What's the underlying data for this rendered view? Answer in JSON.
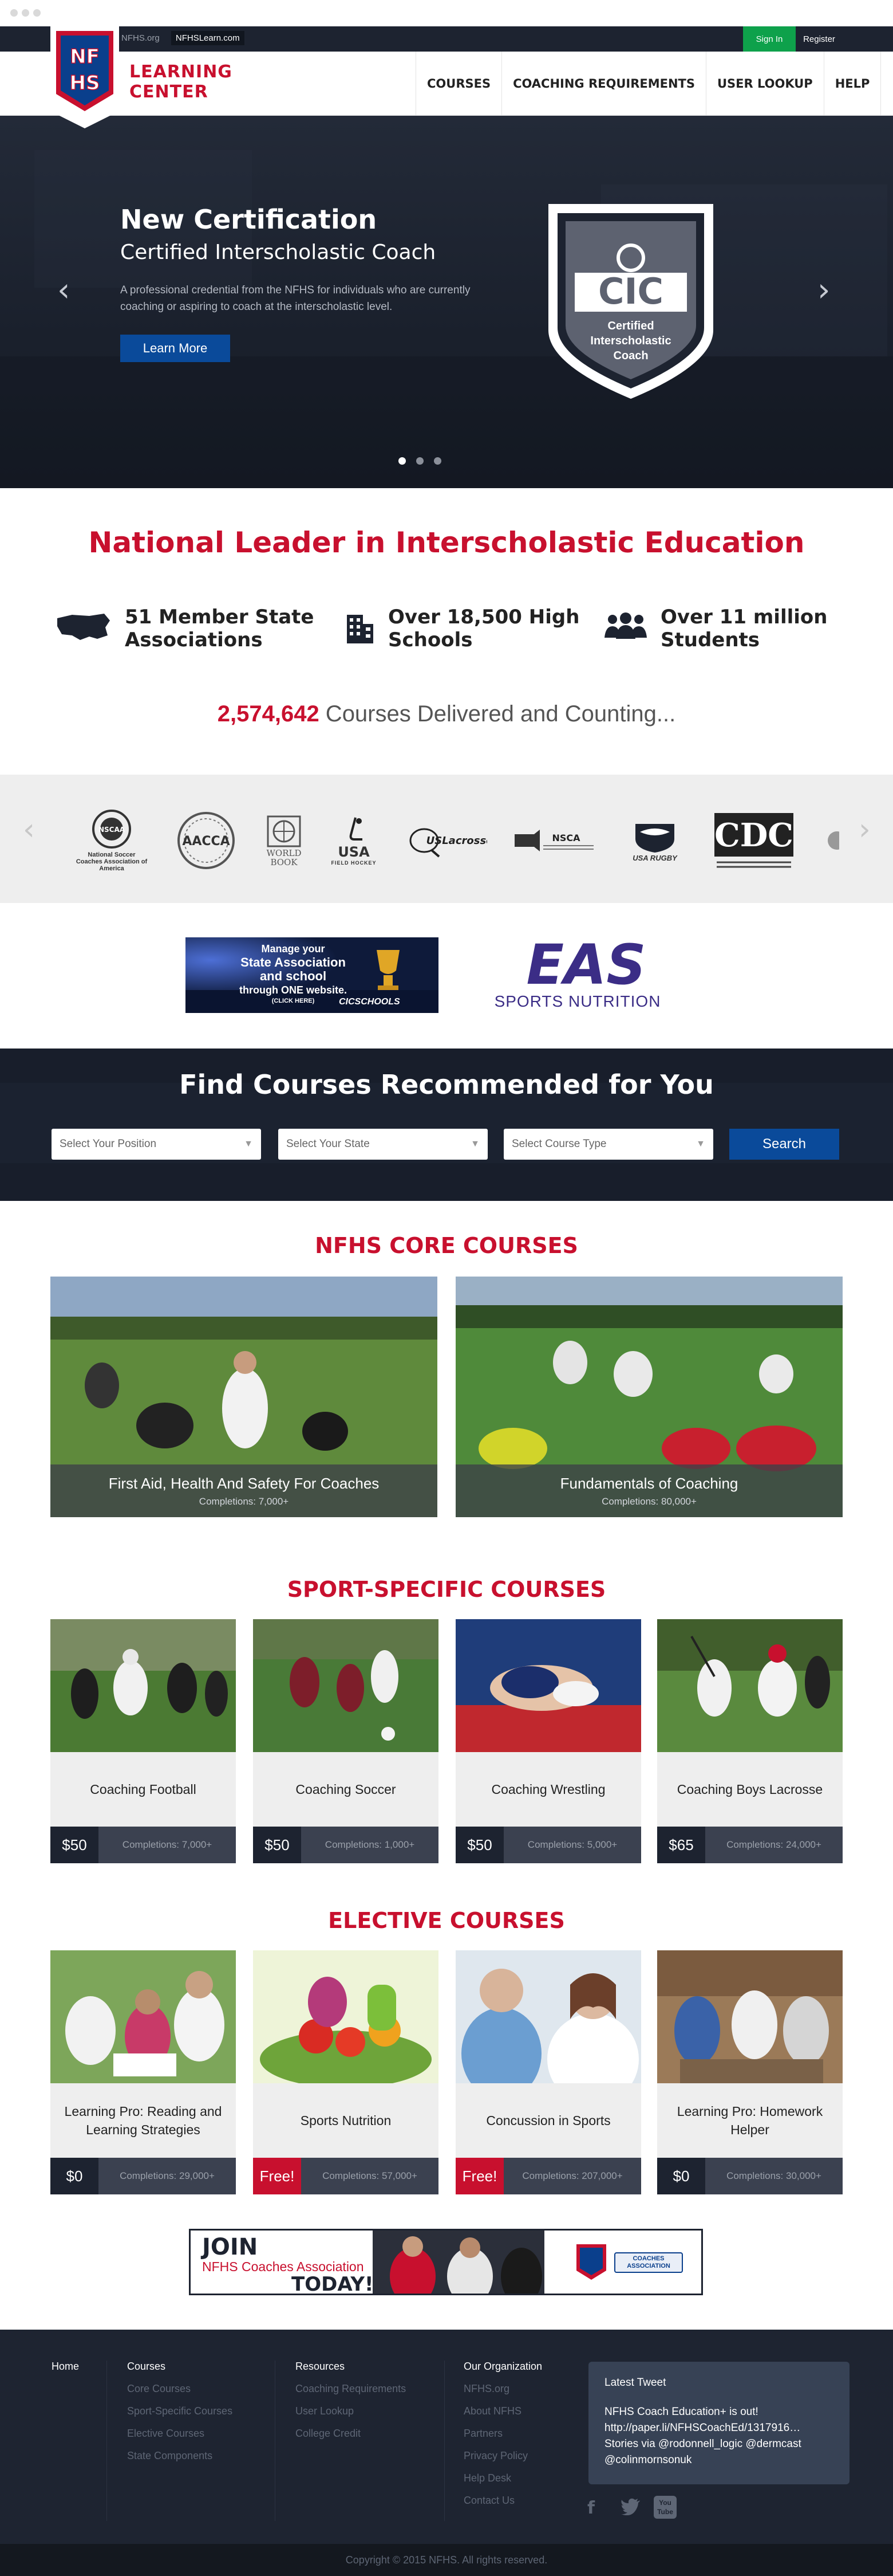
{
  "topbar": {
    "site_link_1": "NFHS.org",
    "site_link_2": "NFHSLearn.com",
    "signin": "Sign In",
    "register": "Register"
  },
  "brand": {
    "logo_text": "NFHS",
    "name_line1": "LEARNING",
    "name_line2": "CENTER"
  },
  "nav": {
    "items": [
      {
        "label": "COURSES"
      },
      {
        "label": "COACHING REQUIREMENTS"
      },
      {
        "label": "USER LOOKUP"
      },
      {
        "label": "HELP"
      }
    ]
  },
  "hero": {
    "title": "New Certification",
    "subtitle": "Certified Interscholastic Coach",
    "description": "A professional credential from the NFHS for individuals who are currently coaching or aspiring to coach at the interscholastic level.",
    "button": "Learn More",
    "badge_abbr": "CIC",
    "badge_line1": "Certified",
    "badge_line2": "Interscholastic",
    "badge_line3": "Coach",
    "active_slide": 1,
    "slide_count": 3
  },
  "leader": {
    "title": "National Leader in Interscholastic Education",
    "stats": [
      {
        "line1": "51 Member State",
        "line2": "Associations",
        "icon": "usa-map-icon"
      },
      {
        "line1": "Over 18,500 High",
        "line2": "Schools",
        "icon": "school-building-icon"
      },
      {
        "line1": "Over 11 million",
        "line2": "Students",
        "icon": "students-group-icon"
      }
    ],
    "count_number": "2,574,642",
    "count_text": " Courses Delivered and Counting..."
  },
  "partners": {
    "items": [
      {
        "name": "National Soccer Coaches Association of America",
        "short": "NSCAA"
      },
      {
        "name": "AACCA",
        "short": "AACCA"
      },
      {
        "name": "WORLD BOOK",
        "short": "WORLD BOOK"
      },
      {
        "name": "USA FIELD HOCKEY",
        "short": "USA"
      },
      {
        "name": "US Lacrosse",
        "short": "USLacrosse"
      },
      {
        "name": "NSCA",
        "short": "NSCA"
      },
      {
        "name": "USA RUGBY",
        "short": "USA RUGBY"
      },
      {
        "name": "CDC",
        "short": "CDC"
      }
    ]
  },
  "ads": {
    "left_line1": "Manage your",
    "left_line2": "State Association",
    "left_line3": "and school",
    "left_line4": "through ONE website.",
    "left_line5": "(CLICK HERE)",
    "left_brand": "CICSCHOOLS",
    "right_brand": "EAS",
    "right_sub": "SPORTS NUTRITION"
  },
  "finder": {
    "title": "Find Courses Recommended for You",
    "position_placeholder": "Select Your Position",
    "state_placeholder": "Select Your State",
    "type_placeholder": "Select Course Type",
    "search": "Search"
  },
  "core": {
    "title": "NFHS CORE COURSES",
    "courses": [
      {
        "title": "First Aid, Health And Safety For Coaches",
        "completions": "Completions: 7,000+"
      },
      {
        "title": "Fundamentals of Coaching",
        "completions": "Completions: 80,000+"
      }
    ]
  },
  "sport": {
    "title": "SPORT-SPECIFIC COURSES",
    "courses": [
      {
        "title": "Coaching Football",
        "price": "$50",
        "completions": "Completions: 7,000+"
      },
      {
        "title": "Coaching Soccer",
        "price": "$50",
        "completions": "Completions: 1,000+"
      },
      {
        "title": "Coaching Wrestling",
        "price": "$50",
        "completions": "Completions: 5,000+"
      },
      {
        "title": "Coaching Boys Lacrosse",
        "price": "$65",
        "completions": "Completions: 24,000+"
      }
    ]
  },
  "elective": {
    "title": "ELECTIVE COURSES",
    "courses": [
      {
        "title": "Learning Pro: Reading and Learning Strategies",
        "price": "$0",
        "completions": "Completions: 29,000+"
      },
      {
        "title": "Sports Nutrition",
        "price": "Free!",
        "completions": "Completions: 57,000+"
      },
      {
        "title": "Concussion in Sports",
        "price": "Free!",
        "completions": "Completions: 207,000+"
      },
      {
        "title": "Learning Pro: Homework Helper",
        "price": "$0",
        "completions": "Completions: 30,000+"
      }
    ]
  },
  "join": {
    "line1": "JOIN",
    "line2": "NFHS Coaches Association",
    "line3": "TODAY!",
    "badge": "COACHES ASSOCIATION"
  },
  "footer": {
    "home": "Home",
    "courses_head": "Courses",
    "courses_links": [
      "Core Courses",
      "Sport-Specific Courses",
      "Elective Courses",
      "State Components"
    ],
    "resources_head": "Resources",
    "resources_links": [
      "Coaching Requirements",
      "User Lookup",
      "College Credit"
    ],
    "org_head": "Our Organization",
    "org_links": [
      "NFHS.org",
      "About NFHS",
      "Partners",
      "Privacy Policy",
      "Help Desk",
      "Contact Us"
    ],
    "tweet_head": "Latest Tweet",
    "tweet_body": "NFHS Coach Education+ is out! http://paper.li/NFHSCoachEd/1317916… Stories via @rodonnell_logic @dermcast @colinmornsonuk",
    "social": [
      "facebook-icon",
      "twitter-icon",
      "youtube-icon"
    ],
    "youtube_label": "You Tube",
    "copyright": "Copyright © 2015 NFHS. All rights reserved."
  },
  "colors": {
    "brand_red": "#c8102e",
    "brand_blue": "#0a4a9a",
    "navy": "#1d2330",
    "signin_green": "#0ea14b"
  }
}
